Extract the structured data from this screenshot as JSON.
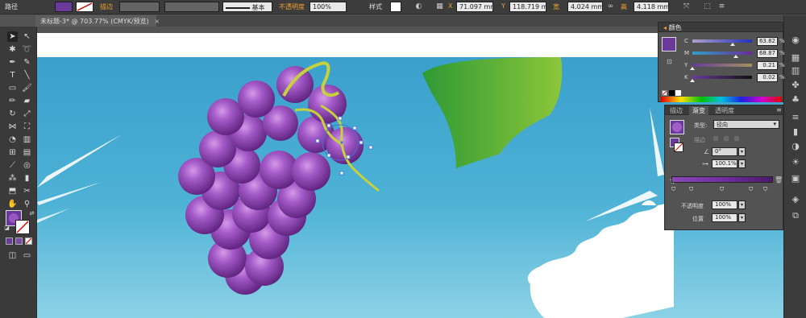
{
  "control_bar": {
    "object_type": "路径",
    "stroke_label": "描边",
    "stroke_profile": "基本",
    "opacity_label": "不透明度",
    "opacity_value": "100%",
    "style_label": "样式",
    "x_label": "X",
    "x_value": "71.097 mm",
    "y_label": "Y",
    "y_value": "118.719 mm",
    "w_label": "宽",
    "w_value": "4.024 mm",
    "h_label": "高",
    "h_value": "4.118 mm"
  },
  "document_tab": {
    "title": "未标题-3* @ 703.77% (CMYK/预览)",
    "close": "×"
  },
  "color_panel": {
    "title": "颜色",
    "sliders": [
      {
        "label": "C",
        "value": "63.82"
      },
      {
        "label": "M",
        "value": "68.87"
      },
      {
        "label": "Y",
        "value": "0.21"
      },
      {
        "label": "K",
        "value": "0.02"
      }
    ],
    "unit": "%"
  },
  "gradient_panel": {
    "tabs": [
      "描边",
      "渐变",
      "透明度"
    ],
    "type_label": "类型:",
    "type_value": "径向",
    "stroke_label": "描边",
    "angle_value": "0°",
    "aspect_value": "100.1%",
    "opacity_label": "不透明度",
    "opacity_value": "100%",
    "location_label": "位置",
    "location_value": "100%"
  },
  "colors": {
    "fill_purple": "#6a3a9a",
    "grape_light": "#b06ad0",
    "grape_dark": "#5a1f7a",
    "sky_top": "#3aa0cc",
    "sky_bottom": "#8fd3e6",
    "leaf_dark": "#2f9a35",
    "leaf_light": "#8cc63a",
    "stem": "#c6d23a",
    "accent_orange": "#f0a030"
  }
}
